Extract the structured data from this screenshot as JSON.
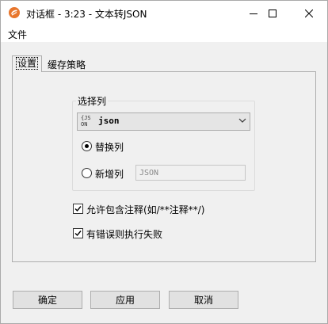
{
  "window": {
    "title": "对话框 - 3:23 - 文本转JSON",
    "icon": "app-logo-icon",
    "controls": [
      "minimize-icon",
      "maximize-icon",
      "close-icon"
    ]
  },
  "menu": {
    "file": "文件"
  },
  "tabs": [
    {
      "label": "设置",
      "active": true
    },
    {
      "label": "缓存策略",
      "active": false
    }
  ],
  "settings": {
    "group_label": "选择列",
    "combo": {
      "icon_text_1": "{JS",
      "icon_text_2": "ON",
      "value": "json"
    },
    "radio_replace": {
      "label": "替换列",
      "checked": true
    },
    "radio_new": {
      "label": "新增列",
      "checked": false
    },
    "new_column_field": {
      "value": "",
      "placeholder": "JSON"
    },
    "check_allow_comments": {
      "label": "允许包含注释(如/**注释**/)",
      "checked": true
    },
    "check_fail_on_error": {
      "label": "有错误则执行失败",
      "checked": true
    }
  },
  "buttons": {
    "ok": "确定",
    "apply": "应用",
    "cancel": "取消"
  },
  "colors": {
    "title_bg": "#ffffff",
    "window_bg": "#f0f0f0",
    "accent_icon": "#e8762c"
  }
}
